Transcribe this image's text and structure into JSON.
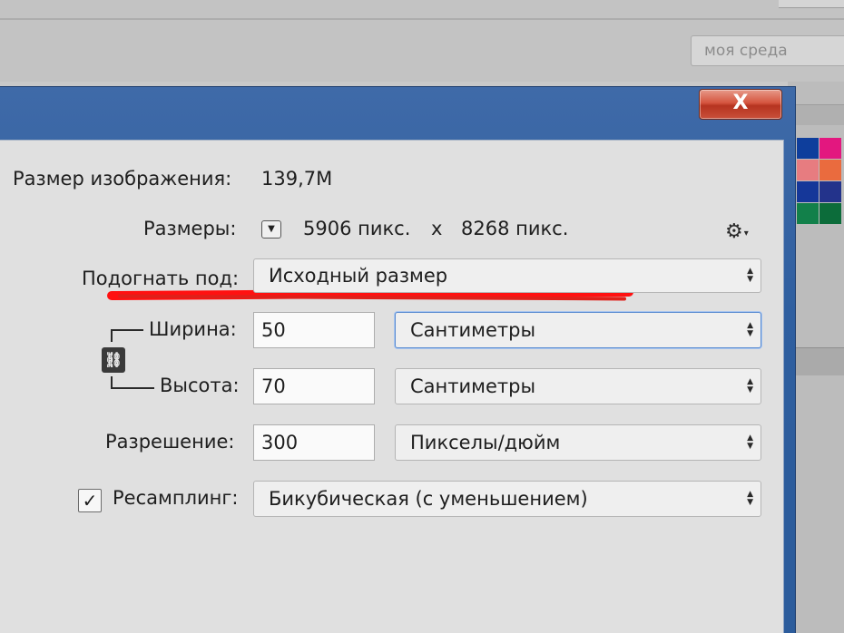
{
  "workspace": {
    "placeholder": "моя среда"
  },
  "dialog": {
    "close_label": "X",
    "image_size_label": "Размер изображения:",
    "image_size_value": "139,7M",
    "dimensions_label": "Размеры:",
    "dimensions_width": "5906 пикс.",
    "dimensions_sep": "x",
    "dimensions_height": "8268 пикс.",
    "fit_to_label": "Подогнать под:",
    "fit_to_value": "Исходный размер",
    "width_label": "Ширина:",
    "width_value": "50",
    "width_unit": "Сантиметры",
    "height_label": "Высота:",
    "height_value": "70",
    "height_unit": "Сантиметры",
    "resolution_label": "Разрешение:",
    "resolution_value": "300",
    "resolution_unit": "Пикселы/дюйм",
    "resample_label": "Ресамплинг:",
    "resample_checked": true,
    "resample_value": "Бикубическая (с уменьшением)"
  },
  "icons": {
    "close": "close-icon",
    "gear": "gear-icon",
    "dropdown": "chevron-down-icon",
    "chain": "link-icon",
    "check": "check-icon",
    "updown": "updown-arrows-icon"
  },
  "colors": {
    "titlebar": "#2f5fa0",
    "close_button": "#c9503a",
    "client_bg": "#e0e0e0",
    "highlight": "#ff1111",
    "focus": "#5a8bd0"
  },
  "swatches": [
    [
      "#0e3e9c",
      "#e3177f"
    ],
    [
      "#e77c80",
      "#ea6b3e"
    ],
    [
      "#153799",
      "#23338b"
    ],
    [
      "#12804a",
      "#0c6c3a"
    ]
  ]
}
